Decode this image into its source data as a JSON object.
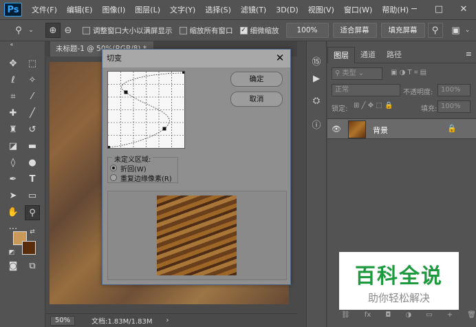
{
  "app": {
    "logo": "Ps"
  },
  "menu": [
    "文件(F)",
    "编辑(E)",
    "图像(I)",
    "图层(L)",
    "文字(Y)",
    "选择(S)",
    "滤镜(T)",
    "3D(D)",
    "视图(V)",
    "窗口(W)",
    "帮助(H)"
  ],
  "window_controls": {
    "minimize": "─",
    "maximize": "□",
    "close": "✕"
  },
  "options": {
    "resize_windows": "调整窗口大小以满屏显示",
    "zoom_all": "缩放所有窗口",
    "scrubby_zoom": "细微缩放",
    "scrubby_checked": "✓",
    "zoom_btn": "100%",
    "fit_screen": "适合屏幕",
    "fill_screen": "填充屏幕"
  },
  "doc": {
    "tab_title": "未标题-1 @ 50%(RGB/8) *",
    "tab_close": "×",
    "zoom": "50%",
    "info": "文档:1.83M/1.83M",
    "arrow": "›"
  },
  "panel": {
    "tabs": [
      "图层",
      "通道",
      "路径"
    ],
    "menu_icon": "≡",
    "filter_kind": "类型",
    "blend_mode": "正常",
    "opacity_label": "不透明度:",
    "opacity_value": "100%",
    "lock_label": "锁定:",
    "fill_label": "填充:",
    "fill_value": "100%",
    "layer_name": "背景",
    "bottom_icons": [
      "⛓",
      "fx",
      "◘",
      "◑",
      "▭",
      "+",
      "🗑"
    ]
  },
  "dialog": {
    "title": "切变",
    "ok": "确定",
    "cancel": "取消",
    "undefined_area": "未定义区域:",
    "wrap_around": "折回(W)",
    "repeat_edge": "重复边缘像素(R)",
    "selected_option": "wrap_around"
  },
  "watermark": {
    "title": "百科全说",
    "subtitle": "助你轻松解决"
  },
  "colors": {
    "fg": "#c9995a",
    "bg": "#5a2d0c",
    "accent_green": "#1d9a3e"
  }
}
